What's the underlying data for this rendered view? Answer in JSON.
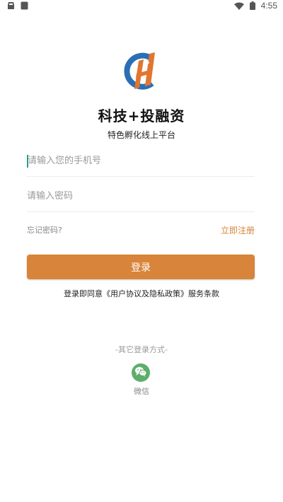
{
  "status_bar": {
    "time": "4:55",
    "left_icons": [
      "notification-icon",
      "sim-card-icon"
    ],
    "right_icons": [
      "wifi-icon",
      "battery-icon"
    ]
  },
  "app": {
    "logo_icon": "app-logo-icon",
    "title": "科技+投融资",
    "subtitle": "特色孵化线上平台"
  },
  "form": {
    "phone_placeholder": "请输入您的手机号",
    "phone_value": "",
    "password_placeholder": "请输入密码",
    "password_value": "",
    "forgot_password": "忘记密码?",
    "register": "立即注册",
    "login_button": "登录",
    "agreement": "登录即同意《用户协议及隐私政策》服务条款"
  },
  "other_login": {
    "heading": "-其它登录方式-",
    "wechat_icon": "wechat-icon",
    "wechat_label": "微信"
  },
  "colors": {
    "accent": "#d8843a",
    "wechat_green": "#5dae6b",
    "logo_blue": "#2a6fb5",
    "logo_orange": "#e0762f",
    "caret": "#2a9d8f"
  }
}
